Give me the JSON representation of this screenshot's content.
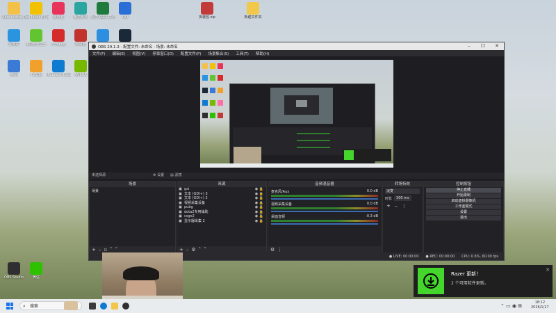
{
  "desktop": {
    "icons": [
      {
        "label": "Administrat...",
        "color": "#f3c04a"
      },
      {
        "label": "PotPlayer 64 bit",
        "color": "#f2c100"
      },
      {
        "label": "此电脑",
        "color": "#e8345a"
      },
      {
        "label": "番茄免费",
        "color": "#2aa5a0"
      },
      {
        "label": "新建 XLSX 工作表.xlsx",
        "color": "#1f7a3e"
      },
      {
        "label": "QQ",
        "color": "#2a6fd6"
      },
      {
        "label": "回收站",
        "color": "#2b94e0"
      },
      {
        "label": "360安全卫士",
        "color": "#63c431"
      },
      {
        "label": "FFmpeg",
        "color": "#d52b2b"
      },
      {
        "label": "网易云",
        "color": "#c2332d"
      },
      {
        "label": "GoLand",
        "color": "#2c8fe0"
      },
      {
        "label": "Steam",
        "color": "#1b2838"
      },
      {
        "label": "腾讯",
        "color": "#3b7bd6"
      },
      {
        "label": "TV剪辑",
        "color": "#f1a02b"
      },
      {
        "label": "Microsoft Edge",
        "color": "#0f7bd0"
      },
      {
        "label": "NVIDIA",
        "color": "#76b900"
      },
      {
        "label": "OBS Studio",
        "color": "#302e31"
      },
      {
        "label": "微信",
        "color": "#2dc100"
      }
    ],
    "top_files": [
      {
        "label": "安装包.zip",
        "color": "#c23a3a"
      },
      {
        "label": "新建文件夹",
        "color": "#f2c84b"
      }
    ]
  },
  "obs": {
    "title": "OBS 29.1.3 - 配置文件: 未命名 - 场景: 未命名",
    "menu": [
      "文件(F)",
      "编辑(E)",
      "视图(V)",
      "停靠窗口(D)",
      "配置文件(P)",
      "场景集合(S)",
      "工具(T)",
      "帮助(H)"
    ],
    "no_source": "未选择源",
    "props_btn": "设置",
    "filters_btn": "滤镜",
    "scenes": {
      "title": "场景",
      "items": [
        "场景"
      ]
    },
    "sources": {
      "title": "来源",
      "items": [
        "gsi",
        "文本 (GDI+) 3",
        "文本 (GDI+) 2",
        "视频采集设备",
        "pubg",
        "dota2专用辅助",
        "csgo2",
        "显示器采集 2"
      ]
    },
    "mixer": {
      "title": "音频混音器",
      "channels": [
        {
          "name": "麦克风/Aux",
          "db": "0.0 dB"
        },
        {
          "name": "视频采集设备",
          "db": "0.0 dB"
        },
        {
          "name": "桌面音频",
          "db": "-0.3 dB"
        }
      ]
    },
    "transitions": {
      "title": "转场特效",
      "type": "淡变",
      "duration_label": "时长",
      "duration": "300 ms"
    },
    "controls": {
      "title": "控制按钮",
      "buttons": [
        "停止直播",
        "开始录制",
        "启动虚拟摄像机",
        "工作室模式",
        "设置",
        "退出"
      ]
    },
    "status": {
      "live": "LIVE: 00:00:00",
      "rec": "REC: 00:00:00",
      "cpu": "CPU: 0.6%, 60.00 fps"
    }
  },
  "notification": {
    "title": "Razer 更新！",
    "message": "2 个可用软件更新。"
  },
  "taskbar": {
    "search_placeholder": "搜索",
    "time": "18:12",
    "date": "2026/1/17"
  }
}
